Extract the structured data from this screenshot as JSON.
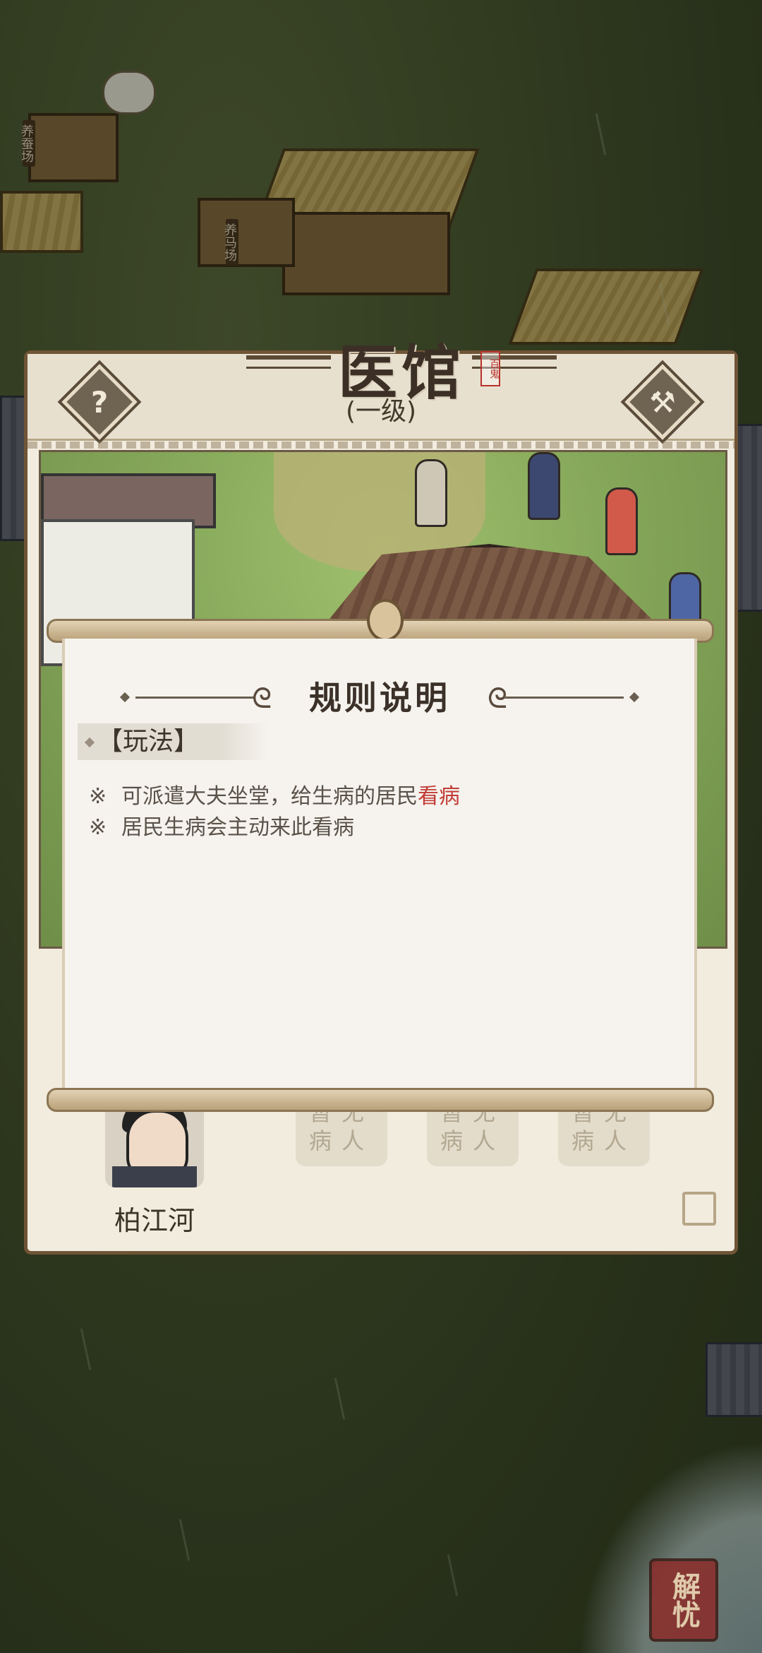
{
  "world": {
    "signs": [
      "养蚕场",
      "养马场"
    ]
  },
  "panel": {
    "title": "医馆",
    "seal_text": "百鬼",
    "level": "(一级)",
    "help_icon": "?",
    "doctor_name": "柏江河",
    "slots": [
      {
        "line1": "暂无",
        "line2": "病人"
      },
      {
        "line1": "暂无",
        "line2": "病人"
      },
      {
        "line1": "暂无",
        "line2": "病人"
      }
    ]
  },
  "dialog": {
    "title": "规则说明",
    "section": "【玩法】",
    "rule_mark": "※",
    "rule1_prefix": "可派遣大夫坐堂，给生病的居民",
    "rule1_highlight": "看病",
    "rule2": "居民生病会主动来此看病"
  },
  "corner_button": "解忧",
  "colors": {
    "panel_border": "#6f5436",
    "highlight_red": "#c23b36",
    "dialog_bg": "#f6f3ee"
  }
}
